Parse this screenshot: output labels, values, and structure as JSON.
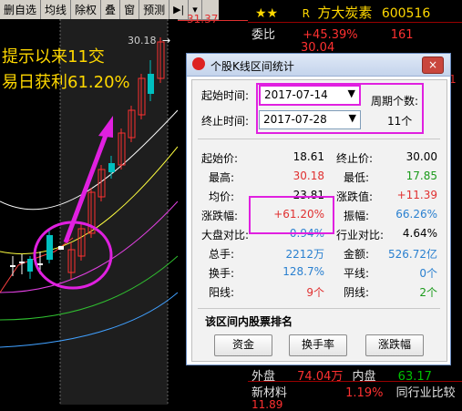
{
  "toolbar": {
    "items": [
      "删自选",
      "均线",
      "除权",
      "叠",
      "窗",
      "预测"
    ],
    "price_top": "31.37"
  },
  "chart": {
    "max_price_label": "30.18",
    "annotation_line1": "提示以来11交",
    "annotation_line2": "易日获利61.20%"
  },
  "stock_panel": {
    "stars": "★★",
    "rating": "R",
    "name": "方大炭素",
    "code": "600516",
    "weibi_label": "委比",
    "weibi_value": "+45.39%",
    "weibi_right": "161",
    "row2_value": "30.04",
    "waipan_label": "外盘",
    "waipan_value": "74.04万",
    "neipan_label": "内盘",
    "neipan_value": "63.17",
    "industry_label": "新材料",
    "industry_value": "1.19%",
    "industry_compare": "同行业比较",
    "last_row_value": "11.89"
  },
  "dialog": {
    "title": "个股K线区间统计",
    "close_label": "×",
    "start_label": "起始时间:",
    "start_value": "2017-07-14",
    "end_label": "终止时间:",
    "end_value": "2017-07-28",
    "period_label": "周期个数:",
    "period_value": "11个",
    "stats": {
      "start_price_label": "起始价:",
      "start_price": "18.61",
      "end_price_label": "终止价:",
      "end_price": "30.00",
      "high_label": "最高:",
      "high": "30.18",
      "low_label": "最低:",
      "low": "17.85",
      "avg_label": "均价:",
      "avg": "23.81",
      "change_value_label": "涨跌值:",
      "change_value": "+11.39",
      "change_pct_label": "涨跌幅:",
      "change_pct": "+61.20%",
      "amplitude_label": "振幅:",
      "amplitude": "66.26%",
      "market_compare_label": "大盘对比:",
      "market_compare": "0.94%",
      "industry_compare_label": "行业对比:",
      "industry_compare": "4.64%",
      "volume_label": "总手:",
      "volume": "2212万",
      "amount_label": "金额:",
      "amount": "526.72亿",
      "turnover_label": "换手:",
      "turnover": "128.7%",
      "flat_label": "平线:",
      "flat": "0个",
      "up_label": "阳线:",
      "up": "9个",
      "down_label": "阴线:",
      "down": "2个"
    },
    "ranking_title": "该区间内股票排名",
    "buttons": [
      "资金",
      "换手率",
      "涨跌幅"
    ]
  },
  "colors": {
    "up": "#e03030",
    "down": "#00c0c0",
    "accent": "#ffd800",
    "highlight": "#e020e0",
    "blue_value": "#2a80d0",
    "green_value": "#1a9a1a"
  }
}
